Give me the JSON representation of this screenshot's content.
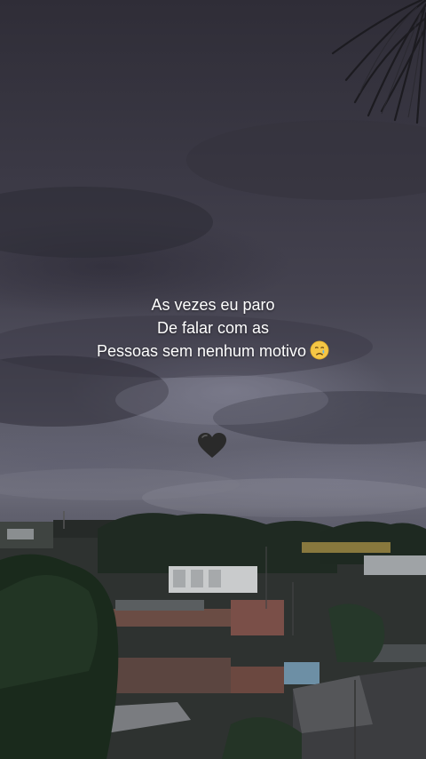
{
  "caption": {
    "line1": "As vezes eu paro",
    "line2": "De falar com as",
    "line3": "Pessoas sem nenhum motivo"
  },
  "icons": {
    "caption_emoji": "crying-face-emoji",
    "decoration": "black-heart-icon"
  },
  "colors": {
    "text": "#ffffff",
    "sky_dark": "#2f2d37",
    "sky_light": "#6a6a78",
    "heart": "#2a2a2a",
    "emoji_face": "#f6c745",
    "emoji_tear": "#5fb3e6"
  }
}
